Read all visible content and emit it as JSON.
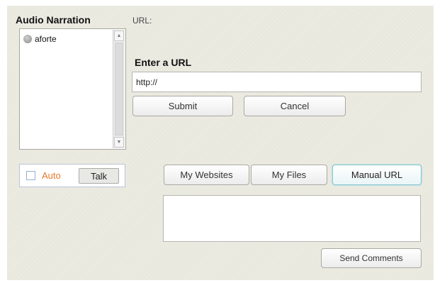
{
  "narration": {
    "title": "Audio Narration",
    "list_items": [
      {
        "label": "aforte",
        "icon": "status-dot-icon"
      }
    ]
  },
  "url_section": {
    "label": "URL:",
    "enter_heading": "Enter a URL",
    "input_value": "http://",
    "submit_label": "Submit",
    "cancel_label": "Cancel"
  },
  "controls": {
    "auto_label": "Auto",
    "auto_checked": false,
    "talk_label": "Talk"
  },
  "tabs": [
    {
      "label": "My Websites",
      "active": false
    },
    {
      "label": "My Files",
      "active": false
    },
    {
      "label": "Manual URL",
      "active": true
    }
  ],
  "comments": {
    "value": "",
    "send_label": "Send Comments"
  },
  "colors": {
    "panel_background": "#ecebe2",
    "auto_label": "#e8782a",
    "active_tab_border": "#82c6cf"
  }
}
